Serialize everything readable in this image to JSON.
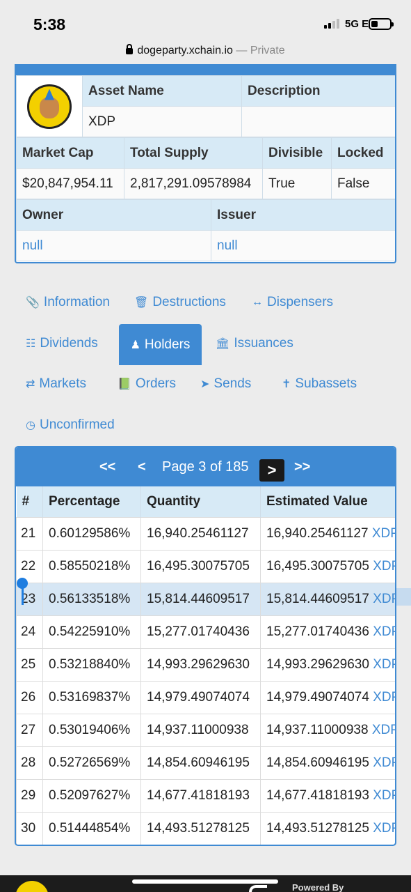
{
  "status_bar": {
    "time": "5:38",
    "network": "5G E"
  },
  "browser": {
    "url": "dogeparty.xchain.io",
    "separator": "—",
    "mode": "Private"
  },
  "asset": {
    "headers": {
      "asset_name": "Asset Name",
      "description": "Description",
      "market_cap": "Market Cap",
      "total_supply": "Total Supply",
      "divisible": "Divisible",
      "locked": "Locked",
      "owner": "Owner",
      "issuer": "Issuer"
    },
    "values": {
      "asset_name": "XDP",
      "description": "",
      "market_cap": "$20,847,954.11",
      "total_supply": "2,817,291.09578984",
      "divisible": "True",
      "locked": "False",
      "owner": "null",
      "issuer": "null"
    }
  },
  "tabs": [
    {
      "label": "Information",
      "icon": "paperclip-icon"
    },
    {
      "label": "Destructions",
      "icon": "trash-icon"
    },
    {
      "label": "Dispensers",
      "icon": "arrows-horizontal-icon"
    },
    {
      "label": "Dividends",
      "icon": "sitemap-icon"
    },
    {
      "label": "Holders",
      "icon": "user-icon",
      "active": true
    },
    {
      "label": "Issuances",
      "icon": "bank-icon"
    },
    {
      "label": "Markets",
      "icon": "exchange-icon"
    },
    {
      "label": "Orders",
      "icon": "book-icon"
    },
    {
      "label": "Sends",
      "icon": "paper-plane-icon"
    },
    {
      "label": "Subassets",
      "icon": "child-icon"
    },
    {
      "label": "Unconfirmed",
      "icon": "clock-icon"
    }
  ],
  "pager": {
    "first": "<<",
    "prev": "<",
    "label": "Page 3 of 185",
    "next": ">",
    "last": ">>"
  },
  "holders_table": {
    "columns": [
      "#",
      "Percentage",
      "Quantity",
      "Estimated Value"
    ],
    "unit": "XDP",
    "rows": [
      {
        "rank": "21",
        "pct": "0.60129586%",
        "qty": "16,940.25461127",
        "value": "16,940.25461127"
      },
      {
        "rank": "22",
        "pct": "0.58550218%",
        "qty": "16,495.30075705",
        "value": "16,495.30075705"
      },
      {
        "rank": "23",
        "pct": "0.56133518%",
        "qty": "15,814.44609517",
        "value": "15,814.44609517"
      },
      {
        "rank": "24",
        "pct": "0.54225910%",
        "qty": "15,277.01740436",
        "value": "15,277.01740436"
      },
      {
        "rank": "25",
        "pct": "0.53218840%",
        "qty": "14,993.29629630",
        "value": "14,993.29629630"
      },
      {
        "rank": "26",
        "pct": "0.53169837%",
        "qty": "14,979.49074074",
        "value": "14,979.49074074"
      },
      {
        "rank": "27",
        "pct": "0.53019406%",
        "qty": "14,937.11000938",
        "value": "14,937.11000938"
      },
      {
        "rank": "28",
        "pct": "0.52726569%",
        "qty": "14,854.60946195",
        "value": "14,854.60946195"
      },
      {
        "rank": "29",
        "pct": "0.52097627%",
        "qty": "14,677.41818193",
        "value": "14,677.41818193"
      },
      {
        "rank": "30",
        "pct": "0.51444854%",
        "qty": "14,493.51278125",
        "value": "14,493.51278125"
      }
    ]
  },
  "footer": {
    "powered_by": "Powered By"
  },
  "colors": {
    "accent": "#3f8ad3",
    "header_bg": "#d7eaf6",
    "selection": "#d6e6f4"
  }
}
